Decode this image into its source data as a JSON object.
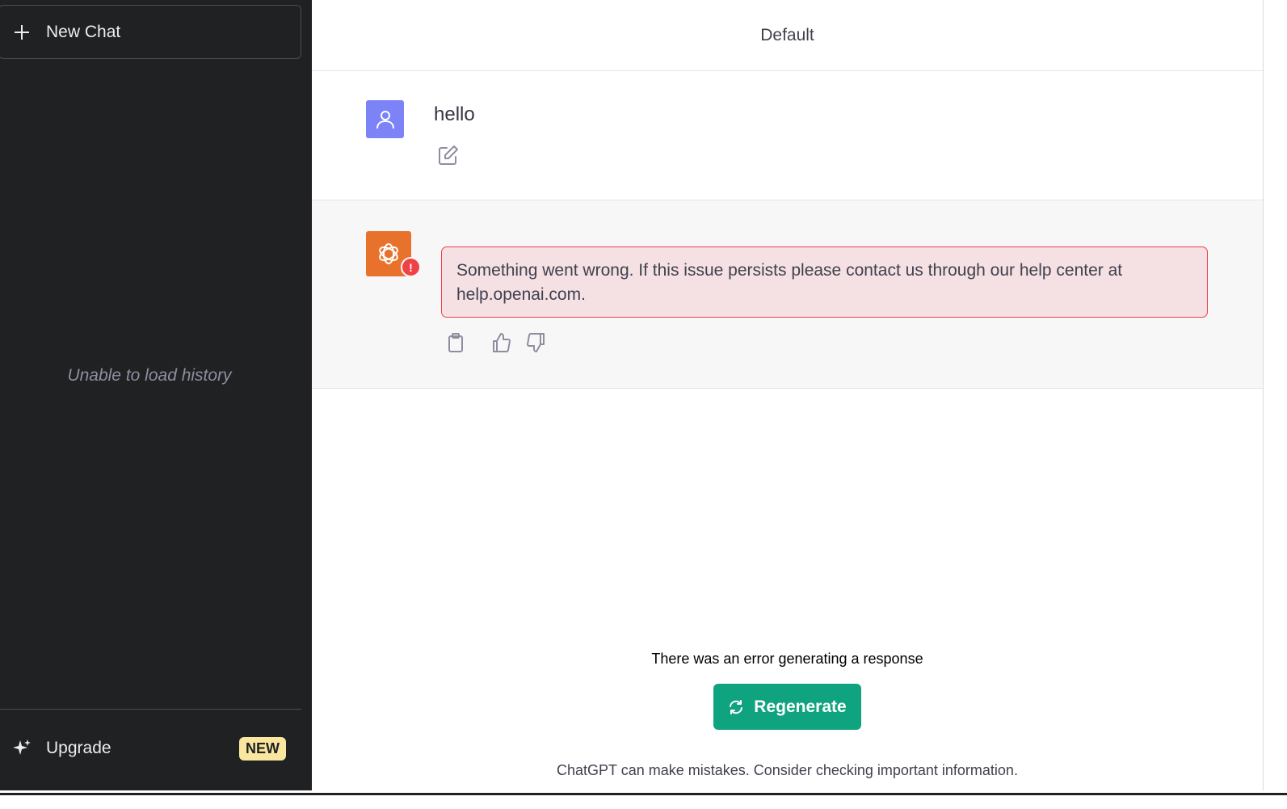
{
  "sidebar": {
    "new_chat_label": "New Chat",
    "history_message": "Unable to load history",
    "upgrade_label": "Upgrade",
    "upgrade_badge": "NEW"
  },
  "header": {
    "model_name": "Default"
  },
  "conversation": {
    "user_message": "hello",
    "error_message": "Something went wrong. If this issue persists please contact us through our help center at help.openai.com.",
    "error_badge": "!"
  },
  "footer": {
    "error_note": "There was an error generating a response",
    "regenerate_label": "Regenerate",
    "disclaimer": "ChatGPT can make mistakes. Consider checking important information."
  },
  "icons": {
    "new_chat": "plus-icon",
    "upgrade": "sparkle-icon",
    "user_avatar": "user-icon",
    "edit": "edit-icon",
    "bot_avatar": "openai-logo-icon",
    "copy": "clipboard-icon",
    "thumbs_up": "thumbs-up-icon",
    "thumbs_down": "thumbs-down-icon",
    "regenerate": "refresh-icon"
  },
  "colors": {
    "sidebar_bg": "#202123",
    "user_avatar": "#7b83f7",
    "bot_avatar": "#e8712c",
    "error_border": "#ef4146",
    "error_bg": "#f5e1e3",
    "accent": "#10a37f",
    "badge_bg": "#fae69e"
  }
}
